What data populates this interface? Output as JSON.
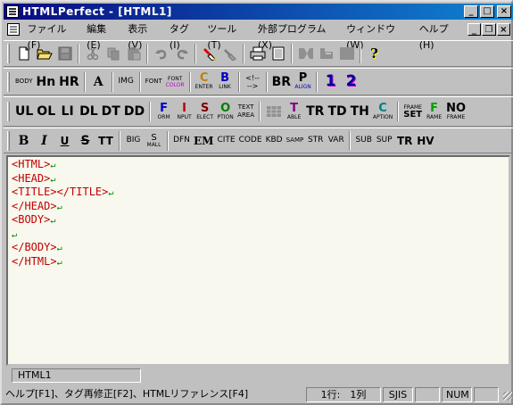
{
  "window": {
    "title": "HTMLPerfect - [HTML1]",
    "caption_buttons": {
      "minimize": "_",
      "maximize": "□",
      "close": "×"
    }
  },
  "menubar": {
    "items": [
      "ファイル(F)",
      "編集(E)",
      "表示(V)",
      "タグ(I)",
      "ツール(T)",
      "外部プログラム(X)",
      "ウィンドウ(W)",
      "ヘルプ(H)"
    ],
    "mdi_buttons": {
      "minimize": "_",
      "restore": "❐",
      "close": "×"
    }
  },
  "toolbar1": {
    "help_glyph": "?",
    "icons": [
      "new-icon",
      "open-icon",
      "save-icon",
      "cut-icon",
      "copy-icon",
      "paste-icon",
      "undo-icon",
      "redo-icon",
      "highlight-icon",
      "eraser-icon",
      "print-icon",
      "preview-icon",
      "tag-ns-icon",
      "tag-ie-icon",
      "block-icon",
      "help-icon"
    ]
  },
  "toolbar2": {
    "body": "BODY",
    "hn": "Hn",
    "hr": "HR",
    "a": "A",
    "img": "IMG",
    "font": "FONT",
    "fontcolor_top": "FONT",
    "fontcolor_bottom": "COLOR",
    "center_top": "C",
    "center_bottom": "ENTER",
    "blink_top": "B",
    "blink_bottom": "LINK",
    "comment_top": "<!--",
    "comment_bottom": "-->",
    "br": "BR",
    "palign_top": "P",
    "palign_bottom": "ALIGN",
    "ol1": "1",
    "ol2": "2"
  },
  "toolbar3": {
    "ul": "UL",
    "ol": "OL",
    "li": "LI",
    "dl": "DL",
    "dt": "DT",
    "dd": "DD",
    "form_top": "F",
    "form_bottom": "ORM",
    "input_top": "I",
    "input_bottom": "NPUT",
    "select_top": "S",
    "select_bottom": "ELECT",
    "option_top": "O",
    "option_bottom": "PTION",
    "textarea_top": "TEXT",
    "textarea_bottom": "AREA",
    "table_top": "T",
    "table_bottom": "ABLE",
    "tr": "TR",
    "td": "TD",
    "th": "TH",
    "caption_top": "C",
    "caption_bottom": "APTION",
    "frameset_top": "FRAME",
    "frameset_bottom": "SET",
    "frame_top": "F",
    "frame_bottom": "RAME",
    "noframe_top": "NO",
    "noframe_bottom": "FRAME"
  },
  "toolbar4": {
    "b": "B",
    "i": "I",
    "u": "U",
    "s": "S",
    "tt": "TT",
    "big": "BIG",
    "small_top": "S",
    "small_bottom": "MALL",
    "dfn": "DFN",
    "em": "EM",
    "cite": "CITE",
    "code": "CODE",
    "kbd": "KBD",
    "samp": "SAMP",
    "str": "STR",
    "var": "VAR",
    "sub": "SUB",
    "sup": "SUP",
    "tr": "TR",
    "hv": "HV"
  },
  "colors": {
    "code_text": "#c00000",
    "eol_mark": "#008000",
    "editor_bg": "#f8f8ee",
    "title_start": "#0a0a80",
    "title_end": "#1084d0"
  },
  "editor": {
    "eol_mark": "↵",
    "lines": [
      "<HTML>",
      "<HEAD>",
      "<TITLE></TITLE>",
      "</HEAD>",
      "<BODY>",
      "",
      "</BODY>",
      "</HTML>"
    ]
  },
  "tabs": [
    "HTML1"
  ],
  "statusbar": {
    "help": "ヘルプ[F1]、タグ再修正[F2]、HTMLリファレンス[F4]",
    "position": "1行:　1列",
    "encoding": "SJIS",
    "num": "NUM"
  }
}
